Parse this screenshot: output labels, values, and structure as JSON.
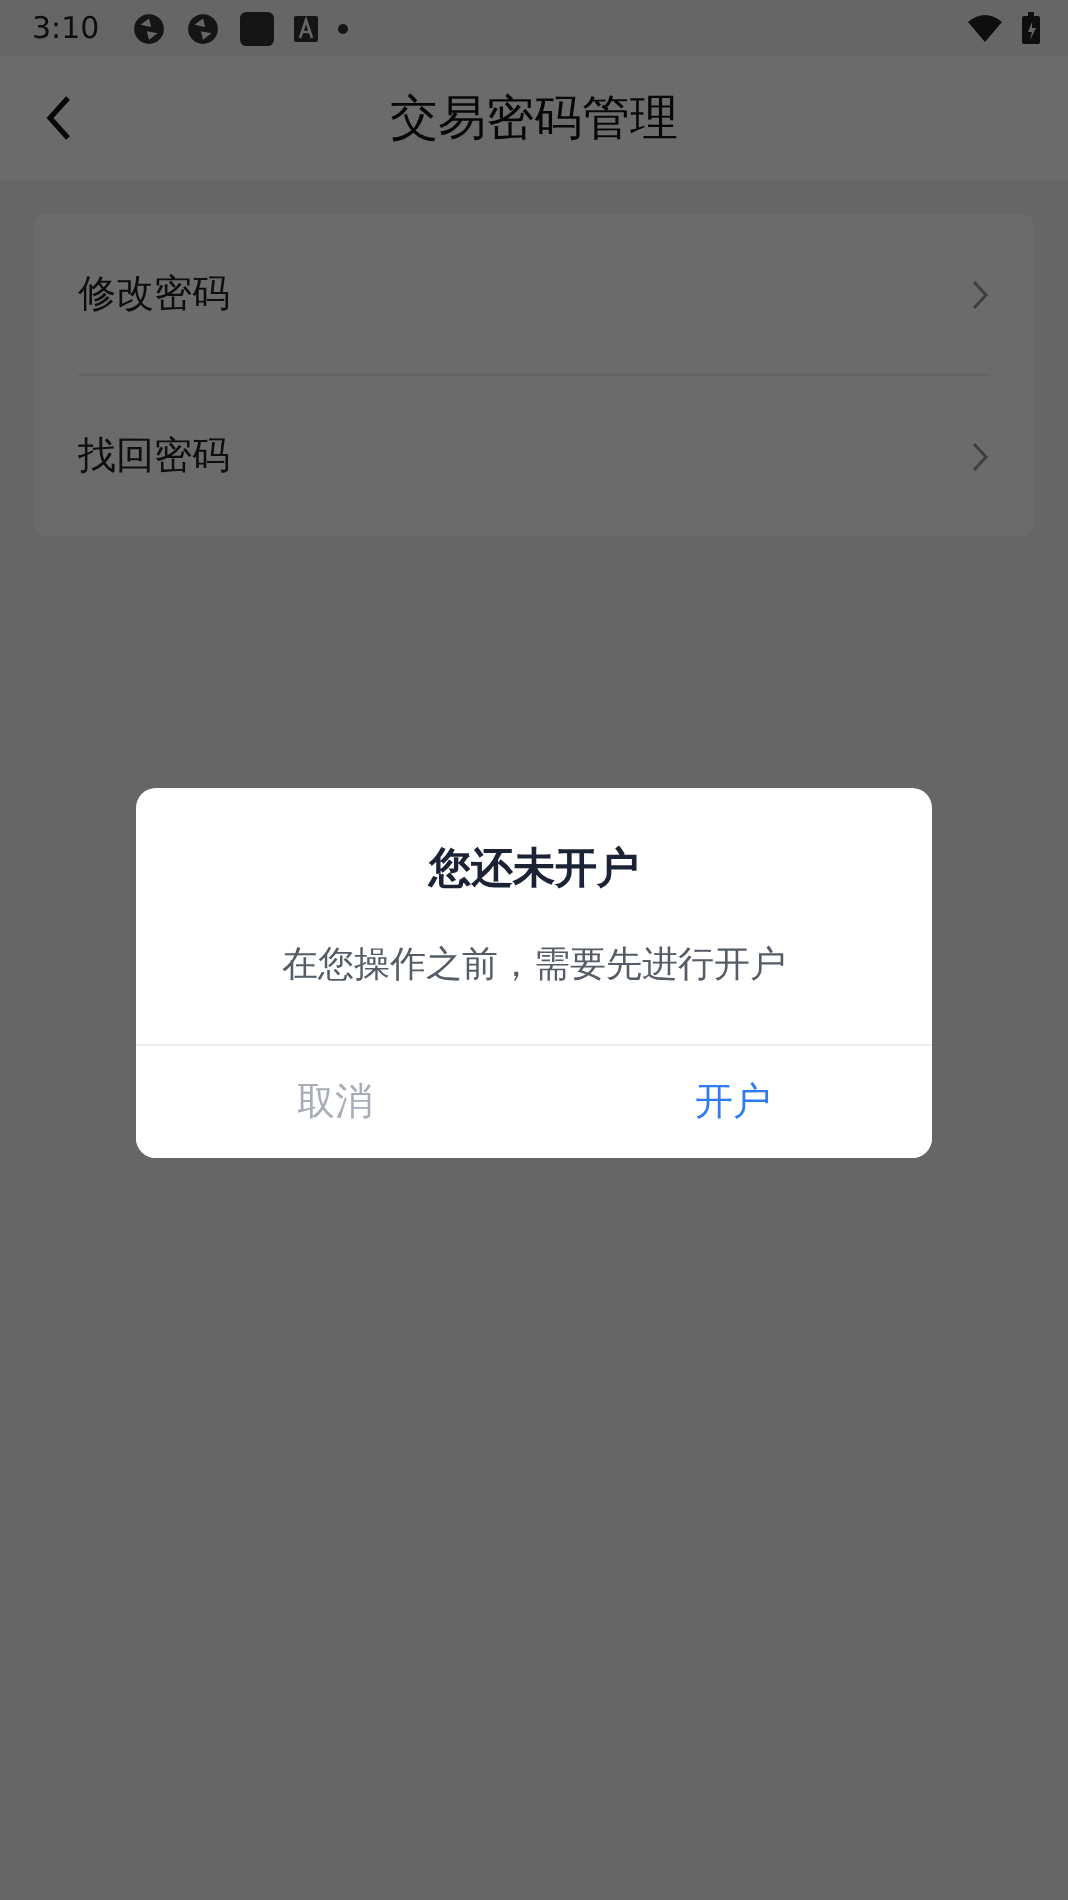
{
  "status_bar": {
    "time": "3:10"
  },
  "header": {
    "title": "交易密码管理"
  },
  "menu": [
    {
      "label": "修改密码"
    },
    {
      "label": "找回密码"
    }
  ],
  "dialog": {
    "title": "您还未开户",
    "message": "在您操作之前，需要先进行开户",
    "buttons": [
      {
        "label": "取消",
        "kind": "cancel"
      },
      {
        "label": "开户",
        "kind": "confirm"
      }
    ]
  }
}
